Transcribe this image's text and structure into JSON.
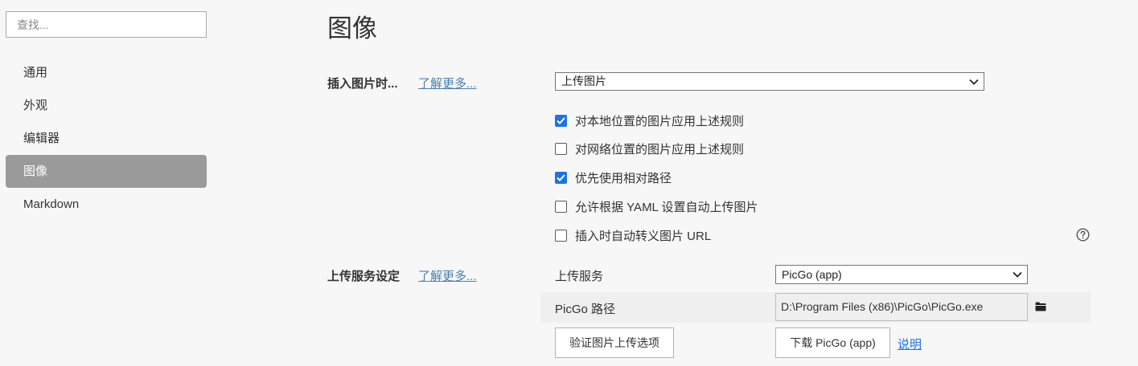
{
  "sidebar": {
    "search_placeholder": "查找...",
    "items": [
      {
        "label": "通用"
      },
      {
        "label": "外观"
      },
      {
        "label": "编辑器"
      },
      {
        "label": "图像",
        "active": true
      },
      {
        "label": "Markdown"
      }
    ]
  },
  "main": {
    "title": "图像",
    "insert_section": {
      "label": "插入图片时...",
      "learn_more": "了解更多...",
      "select_value": "上传图片",
      "checkboxes": [
        {
          "label": "对本地位置的图片应用上述规则",
          "checked": true
        },
        {
          "label": "对网络位置的图片应用上述规则",
          "checked": false
        },
        {
          "label": "优先使用相对路径",
          "checked": true
        },
        {
          "label": "允许根据 YAML 设置自动上传图片",
          "checked": false
        },
        {
          "label": "插入时自动转义图片 URL",
          "checked": false
        }
      ]
    },
    "upload_section": {
      "label": "上传服务设定",
      "learn_more": "了解更多...",
      "service_label": "上传服务",
      "service_value": "PicGo (app)",
      "path_label": "PicGo 路径",
      "path_value": "D:\\Program Files (x86)\\PicGo\\PicGo.exe",
      "verify_button": "验证图片上传选项",
      "download_button": "下载 PicGo (app)",
      "explain_link": "说明"
    }
  },
  "colors": {
    "accent": "#1a73e8",
    "link": "#4a7fb4",
    "active_nav_bg": "#9a9a9a",
    "page_bg": "#f7f7f7"
  },
  "icons": [
    "chevron-down-icon",
    "checkmark-icon",
    "help-icon",
    "folder-icon"
  ]
}
